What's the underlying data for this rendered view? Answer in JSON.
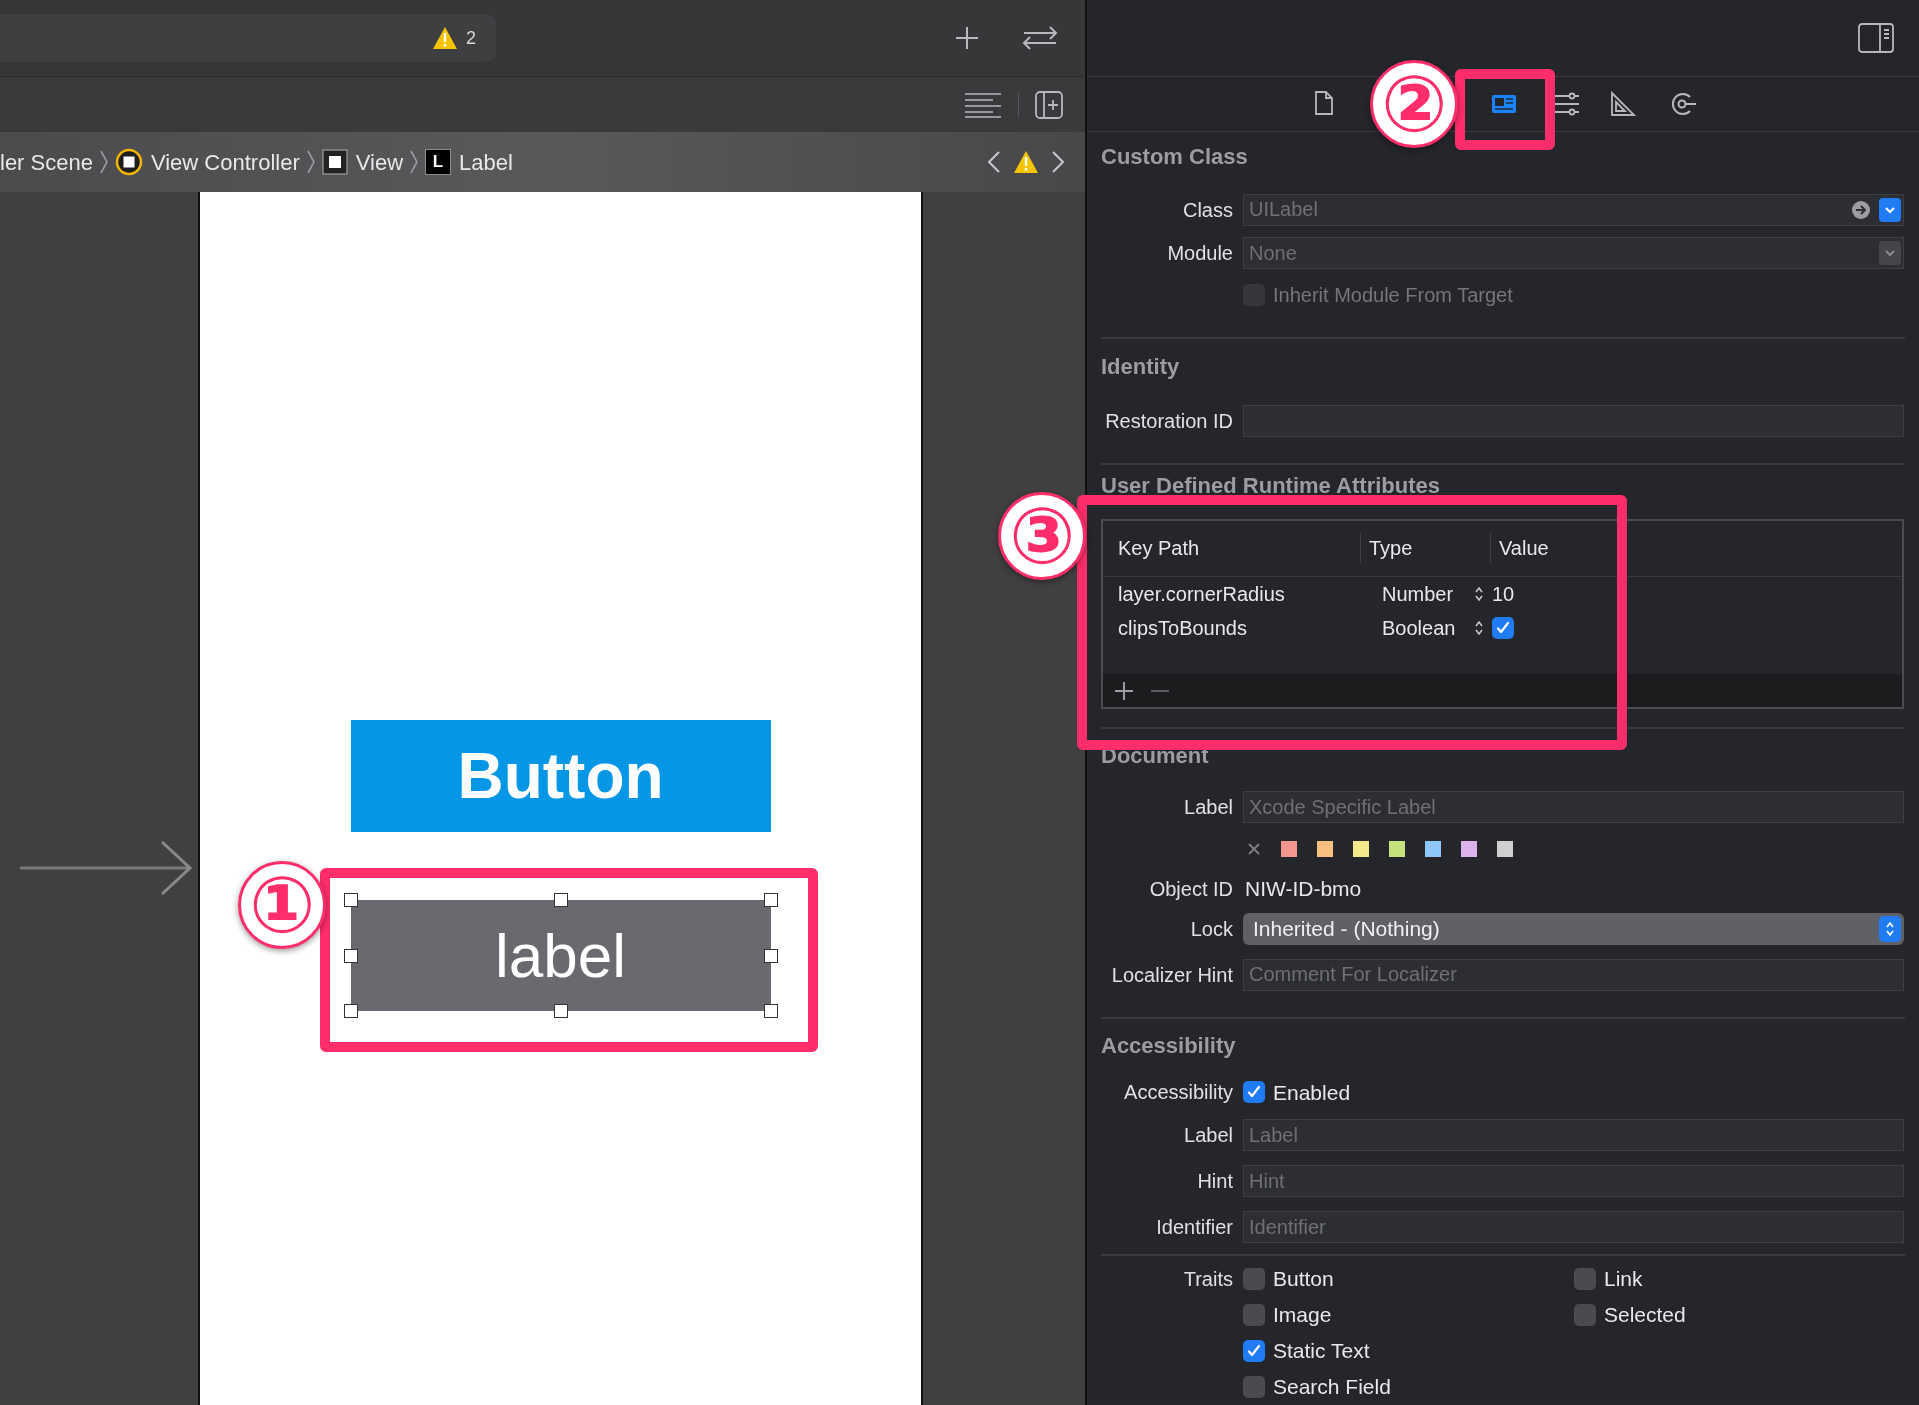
{
  "toolbar": {
    "warning_count": "2"
  },
  "breadcrumb": [
    {
      "label": "ler Scene",
      "kind": "scene"
    },
    {
      "label": "View Controller",
      "kind": "controller"
    },
    {
      "label": "View",
      "kind": "view"
    },
    {
      "label": "Label",
      "kind": "label",
      "icon_letter": "L"
    }
  ],
  "canvas": {
    "button_title": "Button",
    "label_text": "label",
    "label_selected": true
  },
  "inspector": {
    "tabs": [
      {
        "kind": "file",
        "selected": false
      },
      {
        "kind": "identity",
        "selected": true
      },
      {
        "kind": "attributes",
        "selected": false
      },
      {
        "kind": "size",
        "selected": false
      },
      {
        "kind": "connections",
        "selected": false
      }
    ],
    "custom_class": {
      "title": "Custom Class",
      "class_label": "Class",
      "class_placeholder": "UILabel",
      "module_label": "Module",
      "module_placeholder": "None",
      "inherit": {
        "label": "Inherit Module From Target",
        "checked": false,
        "disabled": true
      }
    },
    "identity": {
      "title": "Identity",
      "restoration_label": "Restoration ID"
    },
    "runtime_attributes": {
      "title": "User Defined Runtime Attributes",
      "columns": [
        "Key Path",
        "Type",
        "Value"
      ],
      "rows": [
        {
          "key_path": "layer.cornerRadius",
          "type": "Number",
          "kind": "text",
          "value": "10"
        },
        {
          "key_path": "clipsToBounds",
          "type": "Boolean",
          "kind": "checkbox",
          "checked": true
        }
      ]
    },
    "document": {
      "title": "Document",
      "label_label": "Label",
      "label_placeholder": "Xcode Specific Label",
      "colors": [
        {
          "color": "#f3968f"
        },
        {
          "color": "#f7c07f"
        },
        {
          "color": "#f4e98a"
        },
        {
          "color": "#c5e27c"
        },
        {
          "color": "#8ec7fb"
        },
        {
          "color": "#dcb2ec"
        },
        {
          "color": "#cfcfcf"
        }
      ],
      "object_id_label": "Object ID",
      "object_id": "NIW-ID-bmo",
      "lock_label": "Lock",
      "lock_value": "Inherited - (Nothing)",
      "localizer_label": "Localizer Hint",
      "localizer_placeholder": "Comment For Localizer"
    },
    "accessibility": {
      "title": "Accessibility",
      "enabled_label": "Accessibility",
      "enabled_text": "Enabled",
      "enabled": true,
      "fields": [
        {
          "label": "Label",
          "placeholder": "Label"
        },
        {
          "label": "Hint",
          "placeholder": "Hint"
        },
        {
          "label": "Identifier",
          "placeholder": "Identifier"
        }
      ],
      "traits_label": "Traits",
      "trait_columns": [
        [
          {
            "label": "Button",
            "checked": false
          },
          {
            "label": "Image",
            "checked": false
          },
          {
            "label": "Static Text",
            "checked": true
          },
          {
            "label": "Search Field",
            "checked": false
          }
        ],
        [
          {
            "label": "Link",
            "checked": false
          },
          {
            "label": "Selected",
            "checked": false
          }
        ]
      ]
    }
  },
  "annotations": [
    {
      "text": "①"
    },
    {
      "text": "②"
    },
    {
      "text": "③"
    }
  ]
}
